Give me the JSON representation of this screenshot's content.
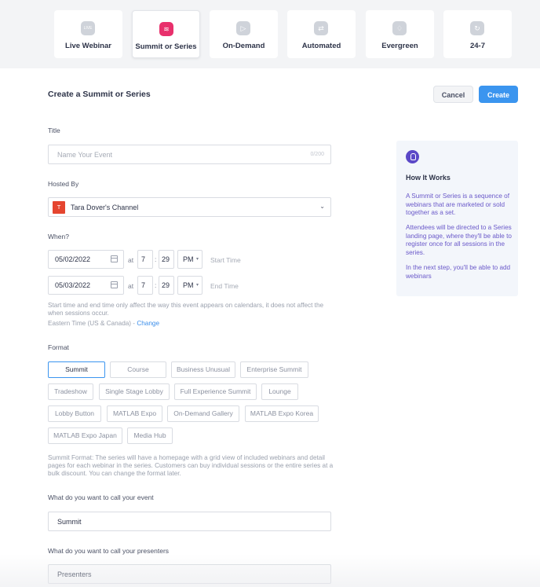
{
  "event_types": [
    {
      "label": "Live Webinar",
      "icon": "live-icon",
      "icon_text": "LIVE"
    },
    {
      "label": "Summit or Series",
      "icon": "layers-icon",
      "icon_text": "≋"
    },
    {
      "label": "On-Demand",
      "icon": "play-icon",
      "icon_text": "▷"
    },
    {
      "label": "Automated",
      "icon": "repeat-icon",
      "icon_text": "⇄"
    },
    {
      "label": "Evergreen",
      "icon": "bell-icon",
      "icon_text": "♢"
    },
    {
      "label": "24-7",
      "icon": "refresh-icon",
      "icon_text": "↻"
    }
  ],
  "header": {
    "title": "Create a Summit or Series",
    "cancel": "Cancel",
    "create": "Create"
  },
  "title_field": {
    "label": "Title",
    "placeholder": "Name Your Event",
    "counter": "0/200"
  },
  "hosted_by": {
    "label": "Hosted By",
    "avatar": "T",
    "value": "Tara Dover's Channel"
  },
  "when": {
    "label": "When?",
    "at": "at",
    "colon": ":",
    "start": {
      "date": "05/02/2022",
      "hour": "7",
      "minute": "29",
      "ampm": "PM",
      "label": "Start Time"
    },
    "end": {
      "date": "05/03/2022",
      "hour": "7",
      "minute": "29",
      "ampm": "PM",
      "label": "End Time"
    },
    "help_line1": "Start time and end time only affect the way this event appears on calendars, it does not affect the",
    "help_line2": "when sessions occur.",
    "timezone": "Eastern Time (US & Canada) - ",
    "change": "Change"
  },
  "format": {
    "label": "Format",
    "options": [
      "Summit",
      "Course",
      "Business Unusual",
      "Enterprise Summit",
      "Tradeshow",
      "Single Stage Lobby",
      "Full Experience Summit",
      "Lounge",
      "Lobby Button",
      "MATLAB Expo",
      "On-Demand Gallery",
      "MATLAB Expo Korea",
      "MATLAB Expo Japan",
      "Media Hub"
    ],
    "selected": "Summit",
    "help_line1": "Summit Format: The series will have a homepage with a grid view of included webinars and detail",
    "help_line2": "pages for each webinar in the series. Customers can buy individual sessions or the entire series at a",
    "help_line3": "bulk discount. You can change the format later."
  },
  "event_name": {
    "label": "What do you want to call your event",
    "value": "Summit"
  },
  "presenters": {
    "label": "What do you want to call your presenters",
    "value": "Presenters"
  },
  "info_panel": {
    "icon": "lightbulb-icon",
    "title": "How It Works",
    "p1": "A Summit or Series is a sequence of webinars that are marketed or sold together as a set.",
    "p2": "Attendees will be directed to a Series landing page, where they'll be able to register once for all sessions in the series.",
    "p3": "In the next step, you'll be able to add webinars"
  },
  "colors": {
    "accent": "#3b95ef",
    "active_tab_icon": "#e8306c",
    "info_text": "#6a59c9",
    "avatar": "#e5452f"
  }
}
